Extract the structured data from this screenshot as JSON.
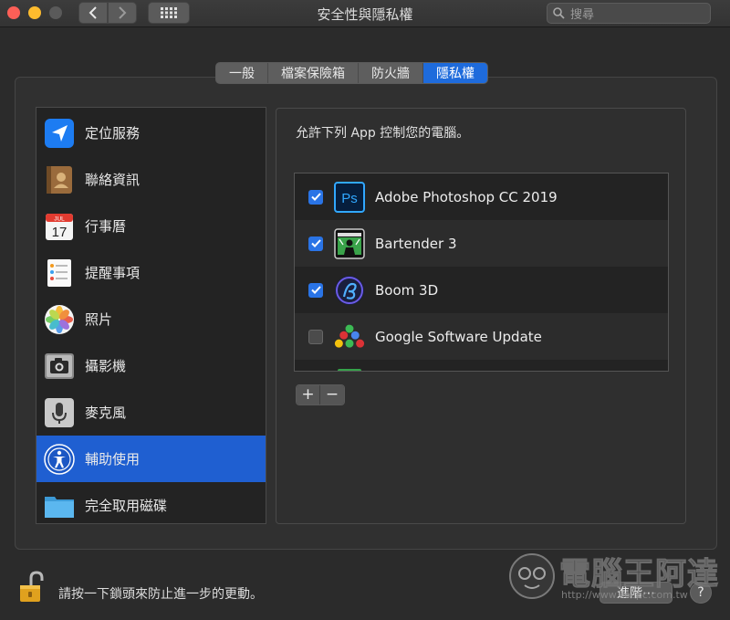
{
  "window": {
    "title": "安全性與隱私權"
  },
  "search": {
    "placeholder": "搜尋"
  },
  "tabs": [
    {
      "label": "一般",
      "active": false
    },
    {
      "label": "檔案保險箱",
      "active": false
    },
    {
      "label": "防火牆",
      "active": false
    },
    {
      "label": "隱私權",
      "active": true
    }
  ],
  "sidebar": {
    "items": [
      {
        "label": "定位服務",
        "icon": "location-arrow-icon"
      },
      {
        "label": "聯絡資訊",
        "icon": "contacts-book-icon"
      },
      {
        "label": "行事曆",
        "icon": "calendar-icon",
        "calendar_month": "JUL",
        "calendar_day": "17"
      },
      {
        "label": "提醒事項",
        "icon": "reminders-list-icon"
      },
      {
        "label": "照片",
        "icon": "photos-flower-icon"
      },
      {
        "label": "攝影機",
        "icon": "camera-icon"
      },
      {
        "label": "麥克風",
        "icon": "microphone-icon"
      },
      {
        "label": "輔助使用",
        "icon": "accessibility-icon",
        "selected": true
      },
      {
        "label": "完全取用磁碟",
        "icon": "folder-icon"
      }
    ]
  },
  "main": {
    "allow_text": "允許下列 App 控制您的電腦。",
    "apps": [
      {
        "name": "Adobe Photoshop CC 2019",
        "checked": true,
        "icon": "photoshop-icon",
        "icon_text": "Ps"
      },
      {
        "name": "Bartender 3",
        "checked": true,
        "icon": "bartender-icon"
      },
      {
        "name": "Boom 3D",
        "checked": true,
        "icon": "boom-3d-icon"
      },
      {
        "name": "Google Software Update",
        "checked": false,
        "icon": "google-software-update-icon"
      }
    ],
    "add_label": "+",
    "remove_label": "−"
  },
  "footer": {
    "lock_text": "請按一下鎖頭來防止進一步的更動。",
    "advanced_label": "進階⋯",
    "help_label": "?"
  },
  "watermark": {
    "text": "電腦王阿達",
    "url": "http://www.kocpc.com.tw"
  },
  "colors": {
    "accent": "#1f5fd1",
    "checkbox": "#2a74e6",
    "background": "#2b2b2b"
  }
}
